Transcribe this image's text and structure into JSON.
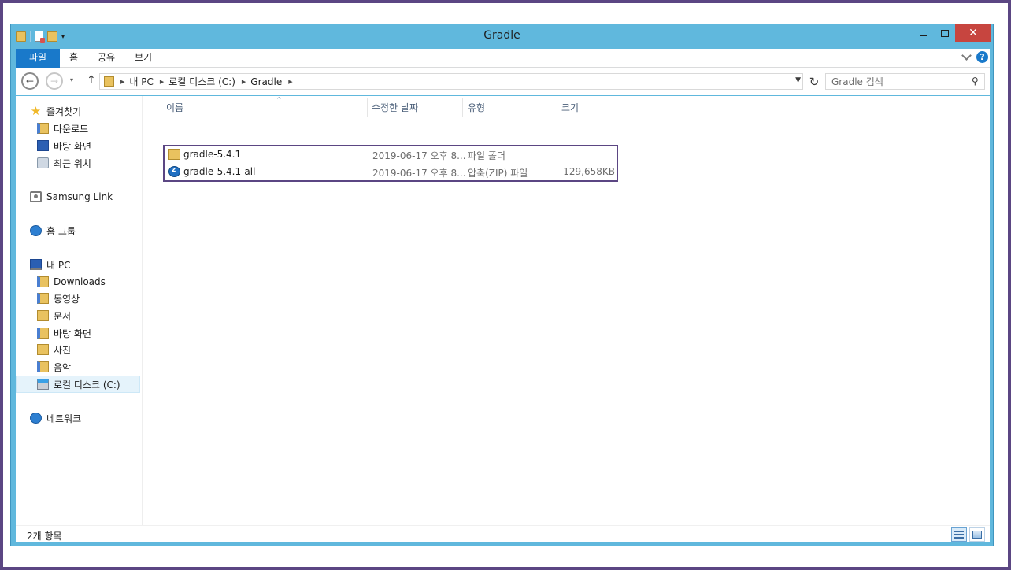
{
  "window": {
    "title": "Gradle",
    "close_glyph": "✕"
  },
  "ribbon": {
    "tabs": [
      "파일",
      "홈",
      "공유",
      "보기"
    ],
    "help_glyph": "?"
  },
  "navigation": {
    "back_glyph": "←",
    "forward_glyph": "→",
    "recent_glyph": "▾",
    "up_glyph": "↑",
    "breadcrumb": [
      "내 PC",
      "로컬 디스크 (C:)",
      "Gradle"
    ],
    "refresh_glyph": "↻",
    "search_placeholder": "Gradle 검색",
    "search_glyph": "⚲"
  },
  "sidebar": {
    "favorites": {
      "label": "즐겨찾기",
      "items": [
        "다운로드",
        "바탕 화면",
        "최근 위치"
      ]
    },
    "samsung_link": "Samsung Link",
    "homegroup": "홈 그룹",
    "this_pc": {
      "label": "내 PC",
      "items": [
        "Downloads",
        "동영상",
        "문서",
        "바탕 화면",
        "사진",
        "음악",
        "로컬 디스크 (C:)"
      ]
    },
    "network": "네트워크"
  },
  "file_list": {
    "columns": [
      "이름",
      "수정한 날짜",
      "유형",
      "크기"
    ],
    "sort_glyph": "^",
    "rows": [
      {
        "name": "gradle-5.4.1",
        "date": "2019-06-17 오후 8...",
        "type": "파일 폴더",
        "size": "",
        "icon": "folder-icon"
      },
      {
        "name": "gradle-5.4.1-all",
        "date": "2019-06-17 오후 8...",
        "type": "압축(ZIP) 파일",
        "size": "129,658KB",
        "icon": "zip-icon"
      }
    ]
  },
  "status": {
    "item_count": "2개 항목"
  },
  "colors": {
    "frame": "#5b4683",
    "titlebar": "#60b8dd",
    "file_tab": "#1979ca",
    "close_button": "#c7453f"
  }
}
